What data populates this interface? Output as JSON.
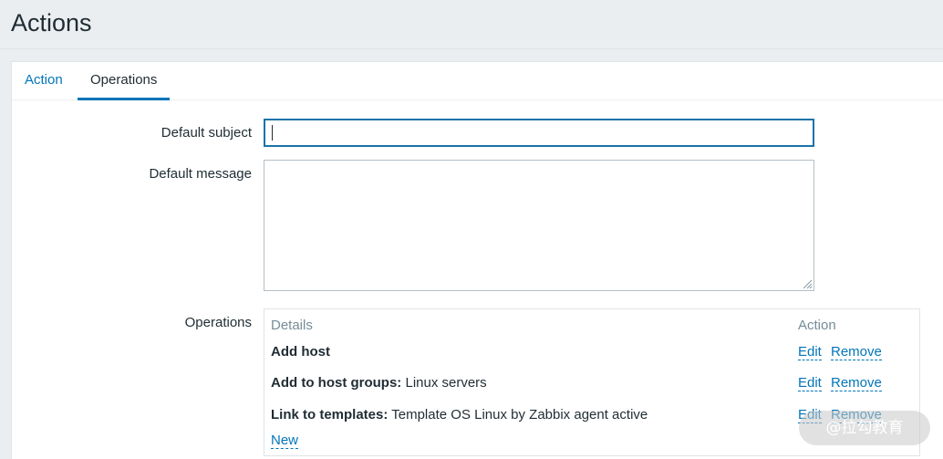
{
  "page": {
    "title": "Actions"
  },
  "tabs": [
    {
      "label": "Action",
      "active": false
    },
    {
      "label": "Operations",
      "active": true
    }
  ],
  "form": {
    "default_subject_label": "Default subject",
    "default_subject_value": "",
    "default_message_label": "Default message",
    "default_message_value": "",
    "operations_label": "Operations"
  },
  "operations": {
    "header_details": "Details",
    "header_action": "Action",
    "rows": [
      {
        "title": "Add host",
        "detail": "",
        "edit": "Edit",
        "remove": "Remove"
      },
      {
        "title": "Add to host groups:",
        "detail": " Linux servers",
        "edit": "Edit",
        "remove": "Remove"
      },
      {
        "title": "Link to templates:",
        "detail": " Template OS Linux by Zabbix agent active",
        "edit": "Edit",
        "remove": "Remove"
      }
    ],
    "new_label": "New"
  },
  "watermark": "@拉勾教育",
  "colors": {
    "background": "#ebeef0",
    "link": "#0275b8",
    "text": "#1f2c33",
    "muted": "#768d99"
  }
}
